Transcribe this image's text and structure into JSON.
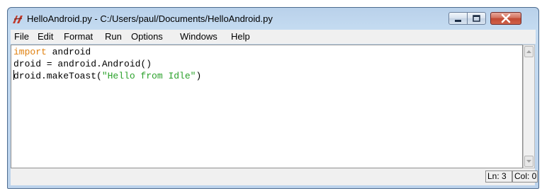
{
  "window": {
    "title": "HelloAndroid.py - C:/Users/paul/Documents/HelloAndroid.py",
    "app_icon": "idle-feather-icon",
    "controls": [
      "minimize-icon",
      "maximize-icon",
      "close-icon"
    ]
  },
  "menu": {
    "items": [
      "File",
      "Edit",
      "Format",
      "Run",
      "Options",
      "Windows",
      "Help"
    ]
  },
  "editor": {
    "lines": [
      {
        "keyword": "import",
        "rest": " android"
      },
      {
        "text": "droid = android.Android()"
      },
      {
        "before": "droid.makeToast(",
        "string": "\"Hello from Idle\"",
        "after": ")"
      }
    ],
    "colors": {
      "keyword": "#e0800f",
      "string": "#2aa12a"
    }
  },
  "status": {
    "line": "Ln: 3",
    "col": "Col: 0"
  }
}
